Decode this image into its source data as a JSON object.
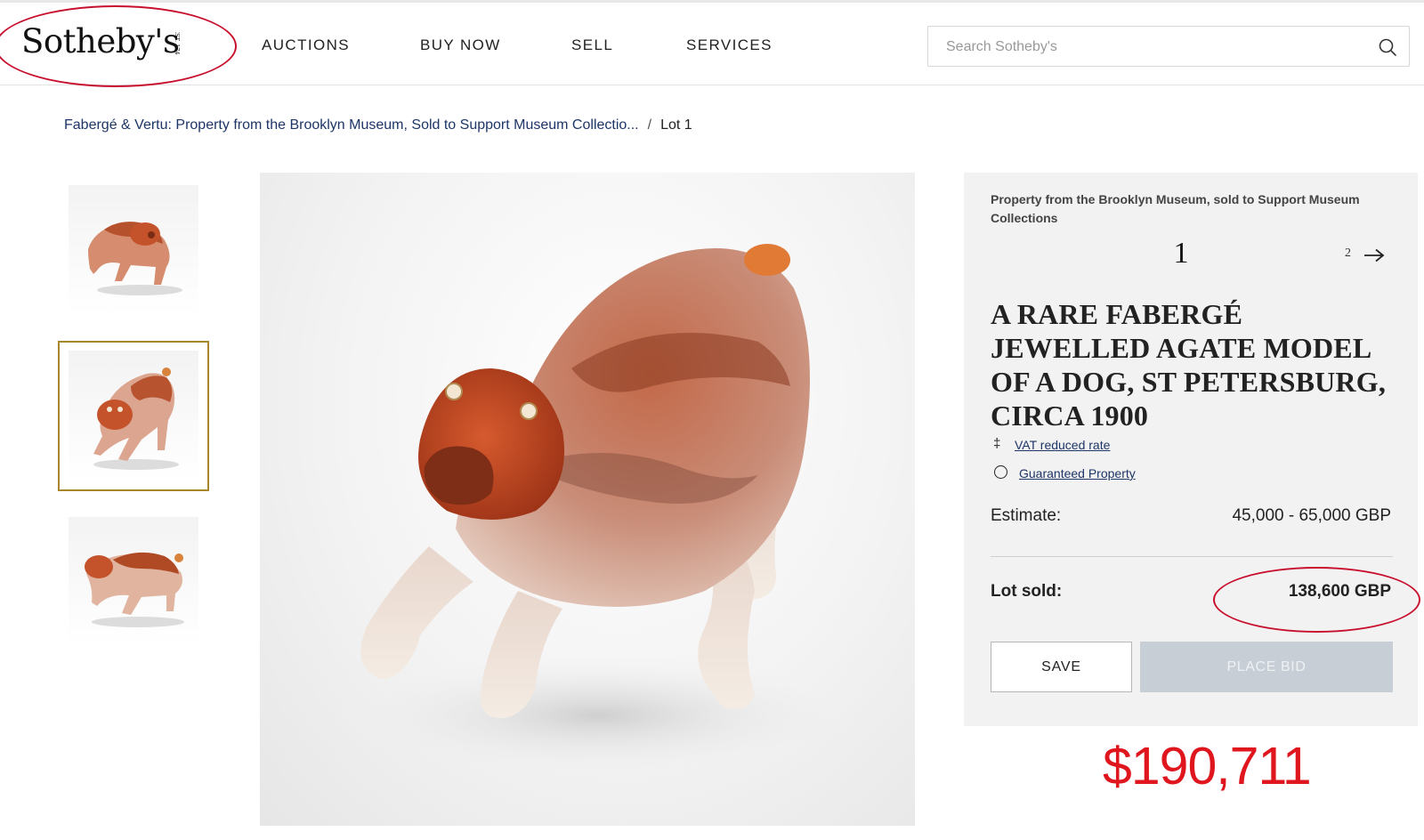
{
  "header": {
    "logo_text": "Sotheby's",
    "logo_est": "EST. 1744",
    "nav": [
      "AUCTIONS",
      "BUY NOW",
      "SELL",
      "SERVICES"
    ],
    "search_placeholder": "Search Sotheby's",
    "search_value": ""
  },
  "breadcrumb": {
    "auction": "Fabergé & Vertu: Property from the Brooklyn Museum, Sold to Support Museum Collectio...",
    "separator": "/",
    "current": "Lot 1"
  },
  "gallery": {
    "thumbnails": [
      "thumb-1",
      "thumb-2",
      "thumb-3"
    ],
    "selected_index": 1
  },
  "lot": {
    "provenance": "Property from the Brooklyn Museum, sold to Support Museum Collections",
    "number": "1",
    "next_number": "2",
    "title": "A RARE FABERGÉ JEWELLED AGATE MODEL OF A DOG, ST PETERSBURG, CIRCA 1900",
    "flags": [
      {
        "symbol": "‡",
        "label": "VAT reduced rate"
      },
      {
        "symbol": "○",
        "label": "Guaranteed Property"
      }
    ],
    "estimate_label": "Estimate:",
    "estimate_value": "45,000 - 65,000 GBP",
    "sold_label": "Lot sold:",
    "sold_value": "138,600 GBP",
    "save_label": "SAVE",
    "bid_label": "PLACE BID"
  },
  "annotation": {
    "usd_price": "$190,711",
    "color": "#e0161e"
  },
  "colors": {
    "link": "#1d3567",
    "panel_bg": "#f2f2f2",
    "selected_frame": "#a8862c",
    "disabled_button": "#c7ced6",
    "annotation_red": "#c8102e"
  }
}
